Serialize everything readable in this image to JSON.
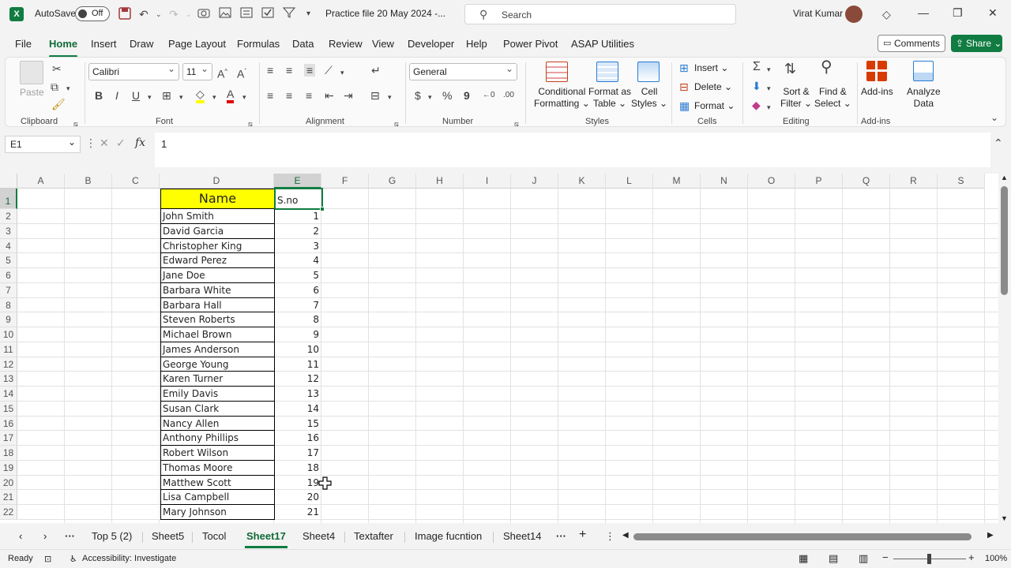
{
  "title": {
    "autosave_label": "AutoSave",
    "autosave_state": "Off",
    "filename": "Practice file 20 May 2024  -...",
    "search_placeholder": "Search",
    "user": "Virat Kumar"
  },
  "menu": [
    "File",
    "Home",
    "Insert",
    "Draw",
    "Page Layout",
    "Formulas",
    "Data",
    "Review",
    "View",
    "Developer",
    "Help",
    "Power Pivot",
    "ASAP Utilities"
  ],
  "menu_active": "Home",
  "actions": {
    "comments": "Comments",
    "share": "Share"
  },
  "ribbon": {
    "paste": "Paste",
    "font_name": "Calibri",
    "font_size": "11",
    "number_format": "General",
    "conditional_formatting": [
      "Conditional",
      "Formatting"
    ],
    "format_as_table": [
      "Format as",
      "Table"
    ],
    "cell_styles": [
      "Cell",
      "Styles"
    ],
    "insert": "Insert",
    "delete": "Delete",
    "format": "Format",
    "sort_filter": [
      "Sort &",
      "Filter"
    ],
    "find_select": [
      "Find &",
      "Select"
    ],
    "addins": "Add-ins",
    "analyze_data": [
      "Analyze",
      "Data"
    ],
    "groups": [
      "Clipboard",
      "Font",
      "Alignment",
      "Number",
      "Styles",
      "Cells",
      "Editing",
      "Add-ins"
    ]
  },
  "formula_bar": {
    "name_box": "E1",
    "formula": "1"
  },
  "columns": [
    "A",
    "B",
    "C",
    "D",
    "E",
    "F",
    "G",
    "H",
    "I",
    "J",
    "K",
    "L",
    "M",
    "N",
    "O",
    "P",
    "Q",
    "R",
    "S"
  ],
  "selected_column": "E",
  "selected_row": "1",
  "rows": [
    "1",
    "2",
    "3",
    "4",
    "5",
    "6",
    "7",
    "8",
    "9",
    "10",
    "11",
    "12",
    "13",
    "14",
    "15",
    "16",
    "17",
    "18",
    "19",
    "20",
    "21",
    "22"
  ],
  "table": {
    "header_name": "Name",
    "header_sno": "S.no",
    "records": [
      {
        "name": "John Smith",
        "sno": "1"
      },
      {
        "name": "David Garcia",
        "sno": "2"
      },
      {
        "name": "Christopher King",
        "sno": "3"
      },
      {
        "name": "Edward Perez",
        "sno": "4"
      },
      {
        "name": "Jane Doe",
        "sno": "5"
      },
      {
        "name": "Barbara White",
        "sno": "6"
      },
      {
        "name": "Barbara Hall",
        "sno": "7"
      },
      {
        "name": "Steven Roberts",
        "sno": "8"
      },
      {
        "name": "Michael Brown",
        "sno": "9"
      },
      {
        "name": "James Anderson",
        "sno": "10"
      },
      {
        "name": "George Young",
        "sno": "11"
      },
      {
        "name": "Karen Turner",
        "sno": "12"
      },
      {
        "name": "Emily Davis",
        "sno": "13"
      },
      {
        "name": "Susan Clark",
        "sno": "14"
      },
      {
        "name": "Nancy Allen",
        "sno": "15"
      },
      {
        "name": "Anthony Phillips",
        "sno": "16"
      },
      {
        "name": "Robert Wilson",
        "sno": "17"
      },
      {
        "name": "Thomas Moore",
        "sno": "18"
      },
      {
        "name": "Matthew Scott",
        "sno": "19"
      },
      {
        "name": "Lisa Campbell",
        "sno": "20"
      },
      {
        "name": "Mary Johnson",
        "sno": "21"
      }
    ]
  },
  "sheet_tabs": [
    "Top 5 (2)",
    "Sheet5",
    "Tocol",
    "Sheet17",
    "Sheet4",
    "Textafter",
    "Image fucntion",
    "Sheet14"
  ],
  "active_sheet": "Sheet17",
  "status": {
    "ready": "Ready",
    "accessibility": "Accessibility: Investigate",
    "zoom": "100%"
  },
  "colors": {
    "accent": "#107c41",
    "header_fill": "#ffff00"
  }
}
